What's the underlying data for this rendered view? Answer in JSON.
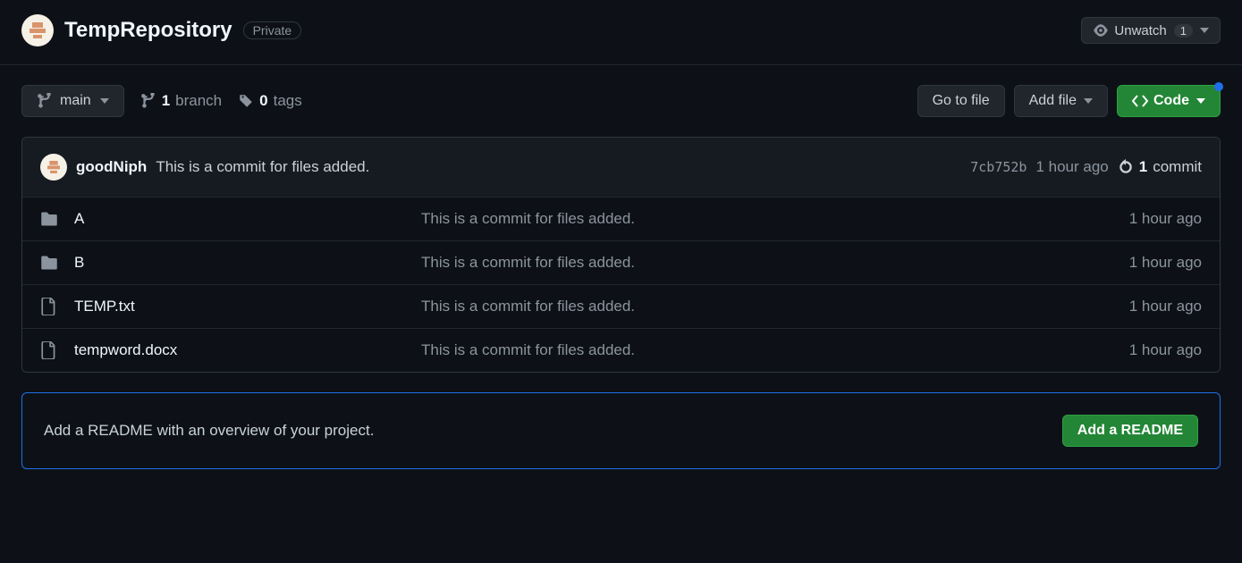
{
  "header": {
    "repo_name": "TempRepository",
    "visibility": "Private",
    "watch_label": "Unwatch",
    "watch_count": "1"
  },
  "toolbar": {
    "branch_name": "main",
    "branch_count": "1",
    "branch_label": "branch",
    "tag_count": "0",
    "tag_label": "tags",
    "go_to_file": "Go to file",
    "add_file": "Add file",
    "code": "Code"
  },
  "commit": {
    "author": "goodNiph",
    "message": "This is a commit for files added.",
    "hash": "7cb752b",
    "time": "1 hour ago",
    "count": "1",
    "count_label": "commit"
  },
  "files": [
    {
      "type": "dir",
      "name": "A",
      "msg": "This is a commit for files added.",
      "time": "1 hour ago"
    },
    {
      "type": "dir",
      "name": "B",
      "msg": "This is a commit for files added.",
      "time": "1 hour ago"
    },
    {
      "type": "file",
      "name": "TEMP.txt",
      "msg": "This is a commit for files added.",
      "time": "1 hour ago"
    },
    {
      "type": "file",
      "name": "tempword.docx",
      "msg": "This is a commit for files added.",
      "time": "1 hour ago"
    }
  ],
  "readme": {
    "hint": "Add a README with an overview of your project.",
    "button": "Add a README"
  }
}
